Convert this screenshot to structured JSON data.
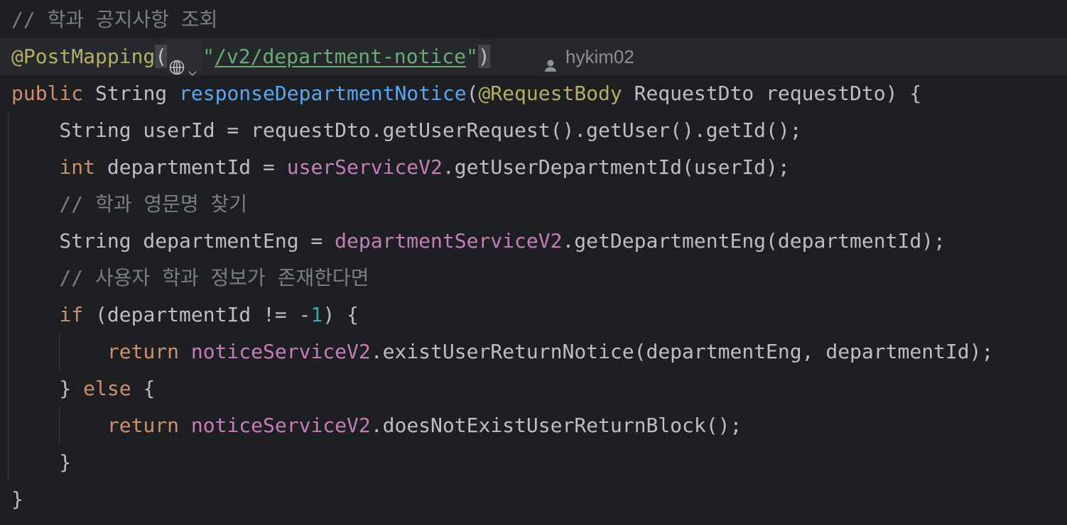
{
  "editor": {
    "lines": [
      {
        "tokens": [
          {
            "t": "// 학과 공지사항 조회",
            "c": "cmt"
          }
        ]
      },
      {
        "tokens": [
          {
            "t": "@PostMapping",
            "c": "ann"
          }
        ]
      },
      {
        "tokens": [
          {
            "t": "public",
            "c": "kw"
          },
          {
            "t": " String ",
            "c": "plain"
          },
          {
            "t": "responseDepartmentNotice",
            "c": "fn"
          },
          {
            "t": "(",
            "c": "plain"
          },
          {
            "t": "@RequestBody",
            "c": "ann"
          },
          {
            "t": " RequestDto requestDto) {",
            "c": "plain"
          }
        ]
      },
      {
        "tokens": [
          {
            "t": "    String userId = requestDto.getUserRequest().getUser().getId();",
            "c": "plain"
          }
        ]
      },
      {
        "tokens": [
          {
            "t": "    ",
            "c": "plain"
          },
          {
            "t": "int",
            "c": "kw"
          },
          {
            "t": " departmentId = ",
            "c": "plain"
          },
          {
            "t": "userServiceV2",
            "c": "field"
          },
          {
            "t": ".getUserDepartmentId(userId);",
            "c": "plain"
          }
        ]
      },
      {
        "tokens": [
          {
            "t": "    // 학과 영문명 찾기",
            "c": "cmt"
          }
        ]
      },
      {
        "tokens": [
          {
            "t": "    String departmentEng = ",
            "c": "plain"
          },
          {
            "t": "departmentServiceV2",
            "c": "field"
          },
          {
            "t": ".getDepartmentEng(departmentId);",
            "c": "plain"
          }
        ]
      },
      {
        "tokens": [
          {
            "t": "    // 사용자 학과 정보가 존재한다면",
            "c": "cmt"
          }
        ]
      },
      {
        "tokens": [
          {
            "t": "    ",
            "c": "plain"
          },
          {
            "t": "if",
            "c": "kw"
          },
          {
            "t": " (departmentId != -",
            "c": "plain"
          },
          {
            "t": "1",
            "c": "num"
          },
          {
            "t": ") {",
            "c": "plain"
          }
        ]
      },
      {
        "tokens": [
          {
            "t": "        ",
            "c": "plain"
          },
          {
            "t": "return",
            "c": "kw"
          },
          {
            "t": " ",
            "c": "plain"
          },
          {
            "t": "noticeServiceV2",
            "c": "field"
          },
          {
            "t": ".existUserReturnNotice(departmentEng, departmentId);",
            "c": "plain"
          }
        ]
      },
      {
        "tokens": [
          {
            "t": "    } ",
            "c": "plain"
          },
          {
            "t": "else",
            "c": "kw"
          },
          {
            "t": " {",
            "c": "plain"
          }
        ]
      },
      {
        "tokens": [
          {
            "t": "        ",
            "c": "plain"
          },
          {
            "t": "return",
            "c": "kw"
          },
          {
            "t": " ",
            "c": "plain"
          },
          {
            "t": "noticeServiceV2",
            "c": "field"
          },
          {
            "t": ".doesNotExistUserReturnBlock();",
            "c": "plain"
          }
        ]
      },
      {
        "tokens": [
          {
            "t": "    }",
            "c": "plain"
          }
        ]
      },
      {
        "tokens": [
          {
            "t": "}",
            "c": "plain"
          }
        ]
      }
    ],
    "annotation_line": {
      "open_paren": "(",
      "url": "\"/v2/department-notice\"",
      "close_paren": ")",
      "author": "hykim02",
      "icons": [
        "globe-icon",
        "chevron-down-icon",
        "user-icon"
      ]
    }
  },
  "colors": {
    "background": "#1e1f22",
    "keyword": "#cf8e6d",
    "function": "#56a8f5",
    "annotation": "#b3ae60",
    "field": "#c77dbb",
    "string": "#6aab73",
    "number": "#2aacb8",
    "comment": "#7a7e85",
    "text": "#bcbec4"
  }
}
